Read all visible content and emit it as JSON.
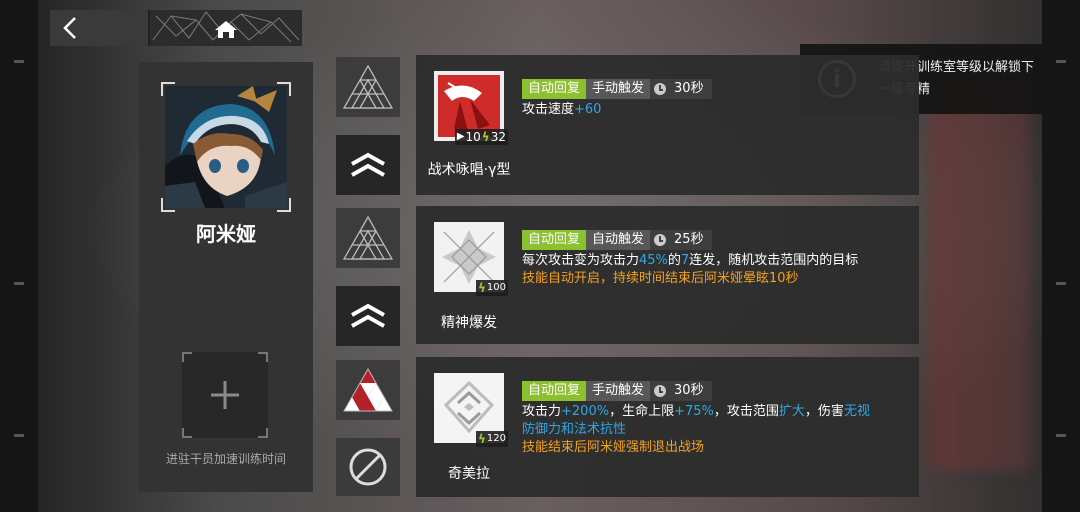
{
  "notice": {
    "text": "请提升训练室等级以解锁下一级专精"
  },
  "operator": {
    "name": "阿米娅",
    "add_hint": "进驻干员加速训练时间"
  },
  "skills": [
    {
      "name": "战术咏唱·γ型",
      "recovery": "自动回复",
      "trigger": "手动触发",
      "duration": "30秒",
      "initial_sp": "10",
      "sp_cost": "32",
      "desc1_prefix": "攻击速度",
      "desc1_value": "+60",
      "icon_color": "#d63333"
    },
    {
      "name": "精神爆发",
      "recovery": "自动回复",
      "trigger": "自动触发",
      "duration": "25秒",
      "sp_cost": "100",
      "desc1_a": "每次攻击变为攻击力",
      "desc1_b": "45%",
      "desc1_c": "的",
      "desc1_d": "7",
      "desc1_e": "连发，随机攻击范围内的目标",
      "desc2": "技能自动开启，持续时间结束后阿米娅晕眩10秒"
    },
    {
      "name": "奇美拉",
      "recovery": "自动回复",
      "trigger": "手动触发",
      "duration": "30秒",
      "sp_cost": "120",
      "desc1_a": "攻击力",
      "desc1_b": "+200%",
      "desc1_c": "，生命上限",
      "desc1_d": "+75%",
      "desc1_e": "，攻击范围",
      "desc1_f": "扩大",
      "desc1_g": "，伤害",
      "desc1_h": "无视",
      "desc2": "防御力和法术抗性",
      "desc3": "技能结束后阿米娅强制退出战场"
    }
  ],
  "colors": {
    "recovery_tag": "#8bc02f",
    "highlight_blue": "#2fa8e6",
    "warning_orange": "#f2a21e",
    "mastery_red": "#b3202a"
  },
  "icons": {
    "back": "chevron-left-icon",
    "home": "home-icon",
    "info": "info-icon",
    "mastery_level": "triangle-mastery-icon",
    "upgrade": "double-chevron-up-icon",
    "locked": "prohibited-icon",
    "add": "plus-icon",
    "clock": "clock-icon",
    "sp": "lightning-bolt-icon"
  }
}
